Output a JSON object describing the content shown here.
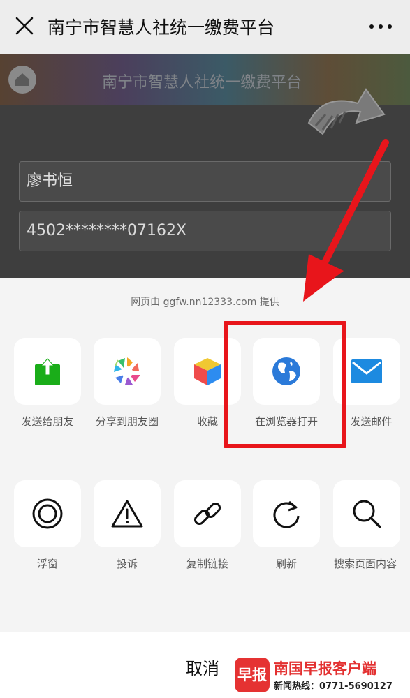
{
  "titlebar": {
    "title": "南宁市智慧人社统一缴费平台",
    "close_icon": "close-icon",
    "more_icon": "more-icon"
  },
  "page": {
    "header_title": "南宁市智慧人社统一缴费平台",
    "name_value": "廖书恒",
    "id_value": "4502********07162X"
  },
  "sheet": {
    "provider": "网页由 ggfw.nn12333.com 提供",
    "share_row": [
      {
        "label": "发送给朋友",
        "icon": "send-to-friend-icon"
      },
      {
        "label": "分享到朋友圈",
        "icon": "moments-icon"
      },
      {
        "label": "收藏",
        "icon": "favorite-icon"
      },
      {
        "label": "在浏览器打开",
        "icon": "browser-globe-icon"
      },
      {
        "label": "发送邮件",
        "icon": "mail-icon"
      }
    ],
    "action_row": [
      {
        "label": "浮窗",
        "icon": "floating-window-icon"
      },
      {
        "label": "投诉",
        "icon": "complaint-warning-icon"
      },
      {
        "label": "复制链接",
        "icon": "copy-link-icon"
      },
      {
        "label": "刷新",
        "icon": "refresh-icon"
      },
      {
        "label": "搜索页面内容",
        "icon": "search-icon"
      }
    ],
    "cancel_label": "取消"
  },
  "watermark": {
    "logo_text": "早报",
    "brand": "南国早报客户端",
    "hotline": "新闻热线：0771-5690127"
  },
  "colors": {
    "highlight": "#e8151b",
    "wechat_green": "#1aad19",
    "mail_blue": "#1d8ae0"
  }
}
